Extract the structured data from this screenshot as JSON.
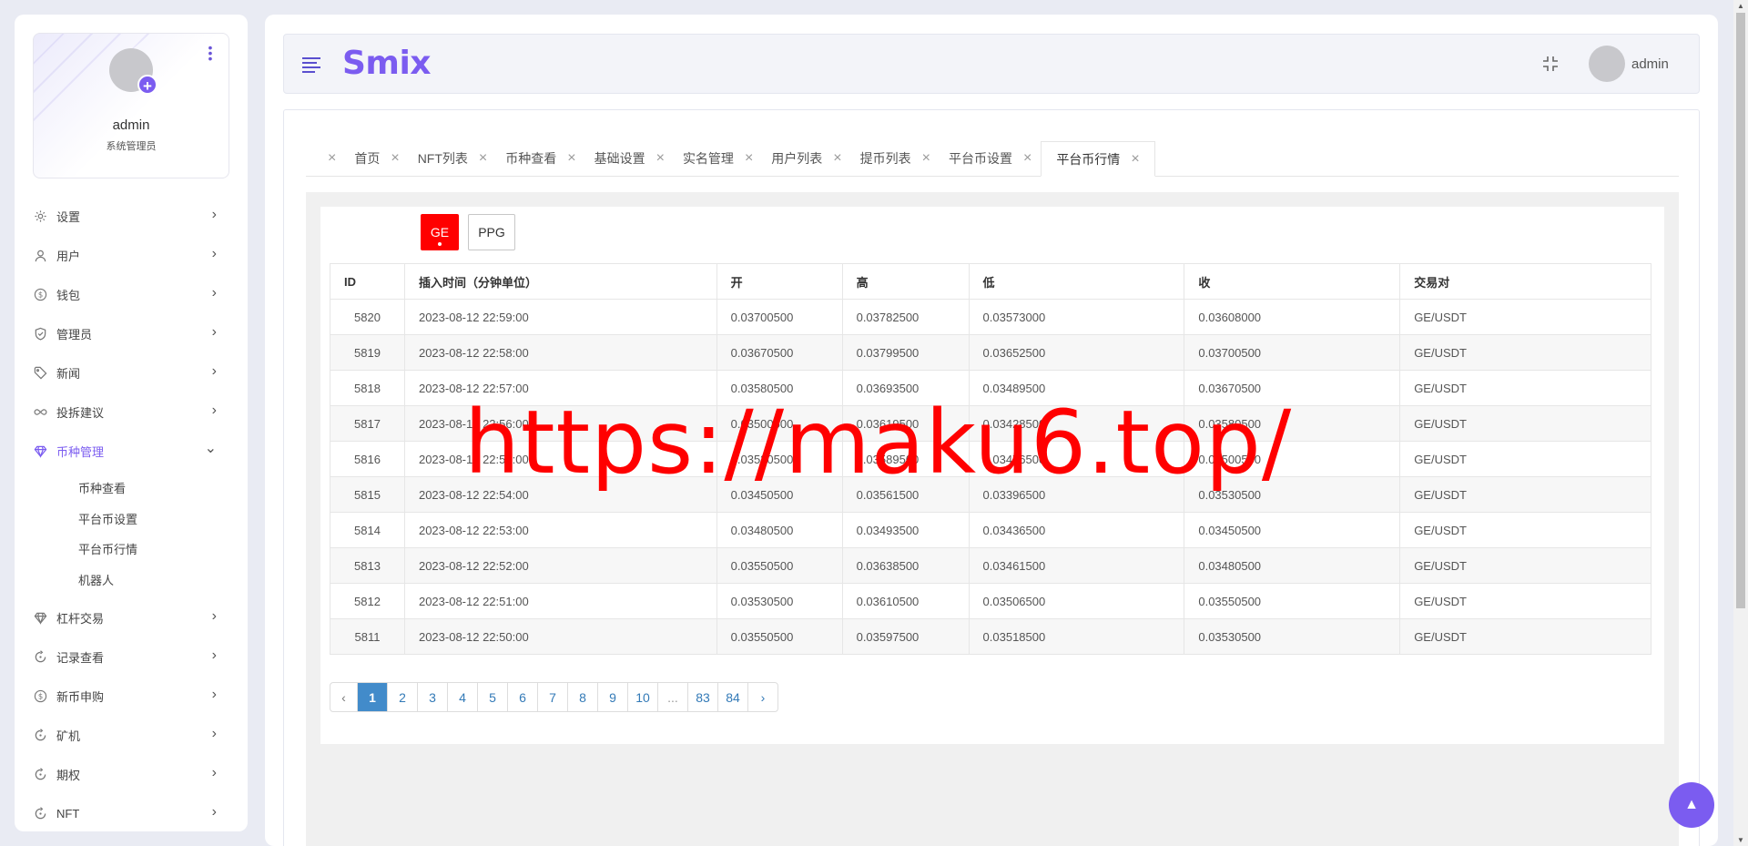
{
  "profile": {
    "name": "admin",
    "role": "系统管理员"
  },
  "sidebar": {
    "items": [
      {
        "label": "设置",
        "icon": "gear-icon"
      },
      {
        "label": "用户",
        "icon": "user-icon"
      },
      {
        "label": "钱包",
        "icon": "dollar-icon"
      },
      {
        "label": "管理员",
        "icon": "shield-icon"
      },
      {
        "label": "新闻",
        "icon": "tag-icon"
      },
      {
        "label": "投拆建议",
        "icon": "infinity-icon"
      },
      {
        "label": "币种管理",
        "icon": "diamond-icon",
        "active": true
      },
      {
        "label": "杠杆交易",
        "icon": "diamond-icon"
      },
      {
        "label": "记录查看",
        "icon": "refresh-icon"
      },
      {
        "label": "新币申购",
        "icon": "dollar-icon"
      },
      {
        "label": "矿机",
        "icon": "refresh-icon"
      },
      {
        "label": "期权",
        "icon": "refresh-icon"
      },
      {
        "label": "NFT",
        "icon": "refresh-icon"
      }
    ],
    "submenu": [
      "币种查看",
      "平台币设置",
      "平台币行情",
      "机器人"
    ]
  },
  "header": {
    "brand": "Smix",
    "user": "admin"
  },
  "tabs": [
    "首页",
    "NFT列表",
    "币种查看",
    "基础设置",
    "实名管理",
    "用户列表",
    "提币列表",
    "平台币设置",
    "平台币行情"
  ],
  "coins": [
    "GE",
    "PPG"
  ],
  "table": {
    "headers": [
      "ID",
      "插入时间（分钟单位）",
      "开",
      "高",
      "低",
      "收",
      "交易对"
    ],
    "rows": [
      [
        "5820",
        "2023-08-12 22:59:00",
        "0.03700500",
        "0.03782500",
        "0.03573000",
        "0.03608000",
        "GE/USDT"
      ],
      [
        "5819",
        "2023-08-12 22:58:00",
        "0.03670500",
        "0.03799500",
        "0.03652500",
        "0.03700500",
        "GE/USDT"
      ],
      [
        "5818",
        "2023-08-12 22:57:00",
        "0.03580500",
        "0.03693500",
        "0.03489500",
        "0.03670500",
        "GE/USDT"
      ],
      [
        "5817",
        "2023-08-12 22:56:00",
        "0.03500500",
        "0.03619500",
        "0.03428500",
        "0.03580500",
        "GE/USDT"
      ],
      [
        "5816",
        "2023-08-12 22:55:00",
        "0.03530500",
        "0.03589500",
        "0.03476500",
        "0.03500500",
        "GE/USDT"
      ],
      [
        "5815",
        "2023-08-12 22:54:00",
        "0.03450500",
        "0.03561500",
        "0.03396500",
        "0.03530500",
        "GE/USDT"
      ],
      [
        "5814",
        "2023-08-12 22:53:00",
        "0.03480500",
        "0.03493500",
        "0.03436500",
        "0.03450500",
        "GE/USDT"
      ],
      [
        "5813",
        "2023-08-12 22:52:00",
        "0.03550500",
        "0.03638500",
        "0.03461500",
        "0.03480500",
        "GE/USDT"
      ],
      [
        "5812",
        "2023-08-12 22:51:00",
        "0.03530500",
        "0.03610500",
        "0.03506500",
        "0.03550500",
        "GE/USDT"
      ],
      [
        "5811",
        "2023-08-12 22:50:00",
        "0.03550500",
        "0.03597500",
        "0.03518500",
        "0.03530500",
        "GE/USDT"
      ]
    ]
  },
  "pagination": [
    "‹",
    "1",
    "2",
    "3",
    "4",
    "5",
    "6",
    "7",
    "8",
    "9",
    "10",
    "...",
    "83",
    "84",
    "›"
  ],
  "pagination_active": "1",
  "watermark": "https://maku6.top/",
  "colors": {
    "accent": "#7b5cf0",
    "active_coin": "#ff0000",
    "page_active": "#428bca"
  }
}
